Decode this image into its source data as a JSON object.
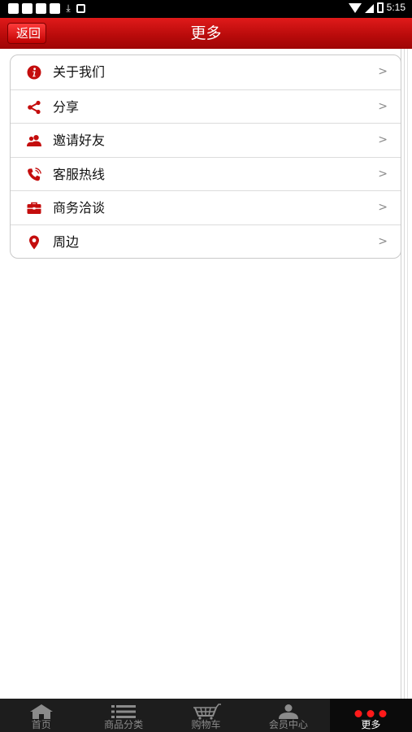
{
  "status_bar": {
    "time": "5:15"
  },
  "header": {
    "back_label": "返回",
    "title": "更多"
  },
  "menu": {
    "items": [
      {
        "label": "关于我们",
        "icon": "info-icon"
      },
      {
        "label": "分享",
        "icon": "share-icon"
      },
      {
        "label": "邀请好友",
        "icon": "invite-friends-icon"
      },
      {
        "label": "客服热线",
        "icon": "phone-icon"
      },
      {
        "label": "商务洽谈",
        "icon": "briefcase-icon"
      },
      {
        "label": "周边",
        "icon": "location-pin-icon"
      }
    ],
    "chevron": ">"
  },
  "tabbar": {
    "tabs": [
      {
        "label": "首页",
        "icon": "home-icon"
      },
      {
        "label": "商品分类",
        "icon": "list-icon"
      },
      {
        "label": "购物车",
        "icon": "cart-icon"
      },
      {
        "label": "会员中心",
        "icon": "user-icon"
      },
      {
        "label": "更多",
        "icon": "more-dots-icon",
        "active": true
      }
    ]
  },
  "colors": {
    "accent": "#c40d0d",
    "header_red": "#b70a0a",
    "tab_active_dots": "#ff1a1a"
  }
}
